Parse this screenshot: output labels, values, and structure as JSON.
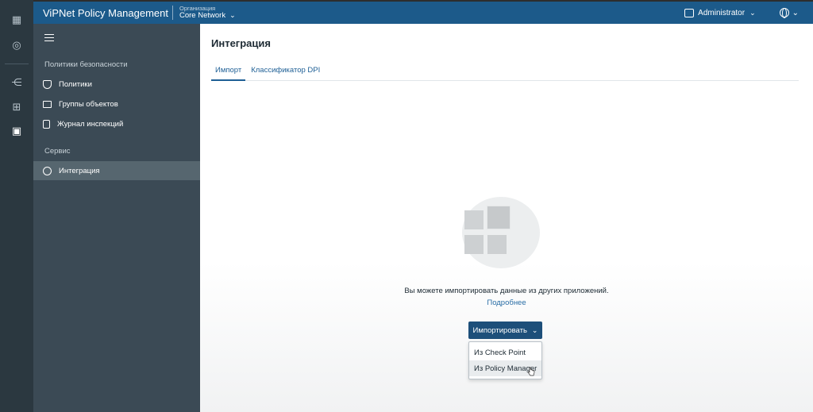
{
  "header": {
    "brand": "ViPNet Policy Management",
    "org_label": "Организация",
    "org_name": "Core Network",
    "user": "Administrator"
  },
  "sidebar": {
    "sections": [
      {
        "title": "Политики безопасности",
        "items": [
          {
            "label": "Политики",
            "icon": "shield-icon"
          },
          {
            "label": "Группы объектов",
            "icon": "folder-icon"
          },
          {
            "label": "Журнал инспекций",
            "icon": "journal-icon"
          }
        ]
      },
      {
        "title": "Сервис",
        "items": [
          {
            "label": "Интеграция",
            "icon": "integration-icon",
            "active": true
          }
        ]
      }
    ]
  },
  "main": {
    "title": "Интеграция",
    "tabs": [
      {
        "label": "Импорт",
        "active": true
      },
      {
        "label": "Классификатор DPI"
      }
    ],
    "info_text": "Вы можете импортировать данные из других приложений.",
    "more_link": "Подробнее",
    "import_button": "Импортировать",
    "import_menu": [
      "Из Check Point",
      "Из Policy Manager"
    ]
  },
  "colors": {
    "header_bg": "#1c5a8a",
    "sidebar_bg": "#3b4a55",
    "rail_bg": "#2b3840",
    "accent": "#1d4f7a"
  }
}
